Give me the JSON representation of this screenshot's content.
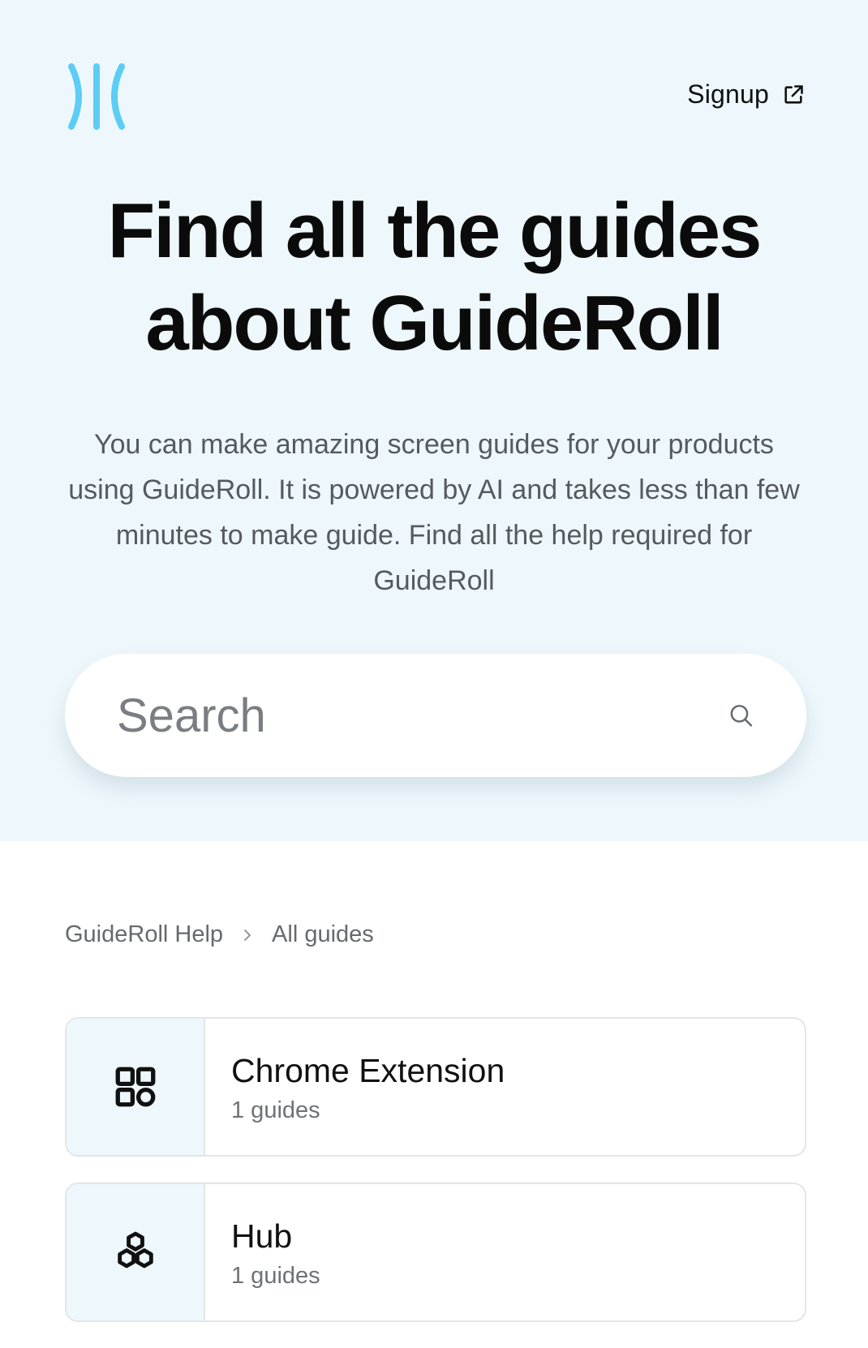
{
  "header": {
    "signup_label": "Signup"
  },
  "hero": {
    "title_line1": "Find all the guides",
    "title_line2": "about GuideRoll",
    "description": "You can make amazing screen guides for your products using GuideRoll. It is powered by AI and takes less than few minutes to make guide. Find all the help required for GuideRoll"
  },
  "search": {
    "placeholder": "Search"
  },
  "breadcrumb": {
    "items": [
      "GuideRoll Help",
      "All guides"
    ]
  },
  "collections": [
    {
      "title": "Chrome Extension",
      "count": "1 guides",
      "icon": "apps-grid-icon"
    },
    {
      "title": "Hub",
      "count": "1 guides",
      "icon": "hexagons-icon"
    }
  ],
  "colors": {
    "hero_bg": "#eef8fc",
    "brand_accent": "#5ccdf4",
    "text_primary": "#111111",
    "text_muted": "#6e7276"
  }
}
